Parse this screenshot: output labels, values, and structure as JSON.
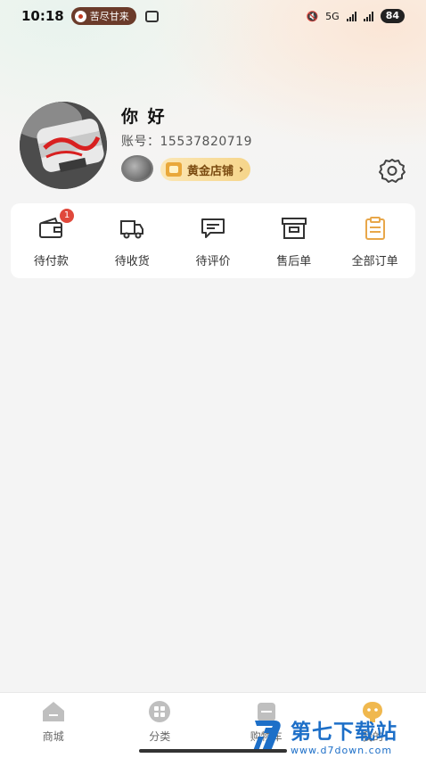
{
  "status_bar": {
    "time": "10:18",
    "music_text": "苦尽甘来",
    "network": "5G",
    "battery": "84"
  },
  "profile": {
    "nickname": "你 好",
    "account": "账号：15537820719",
    "level_label": "黄金店铺",
    "level_arrow": "›"
  },
  "orders": [
    {
      "label": "待付款",
      "icon": "wallet-icon",
      "badge": "1"
    },
    {
      "label": "待收货",
      "icon": "truck-icon",
      "badge": ""
    },
    {
      "label": "待评价",
      "icon": "comment-icon",
      "badge": ""
    },
    {
      "label": "售后单",
      "icon": "after-sales-icon",
      "badge": ""
    },
    {
      "label": "全部订单",
      "icon": "clipboard-icon",
      "badge": ""
    }
  ],
  "bottom_nav": [
    {
      "label": "商城",
      "icon": "home-icon"
    },
    {
      "label": "分类",
      "icon": "category-icon"
    },
    {
      "label": "购物车",
      "icon": "cart-icon"
    },
    {
      "label": "我的",
      "icon": "profile-icon"
    }
  ],
  "watermark": {
    "title": "第七下载站",
    "url": "www.d7down.com"
  },
  "colors": {
    "accent_orange": "#e8a74a",
    "badge_red": "#e0483b",
    "vip_gold": "#f6d58a",
    "watermark_blue": "#1d6fc8"
  }
}
